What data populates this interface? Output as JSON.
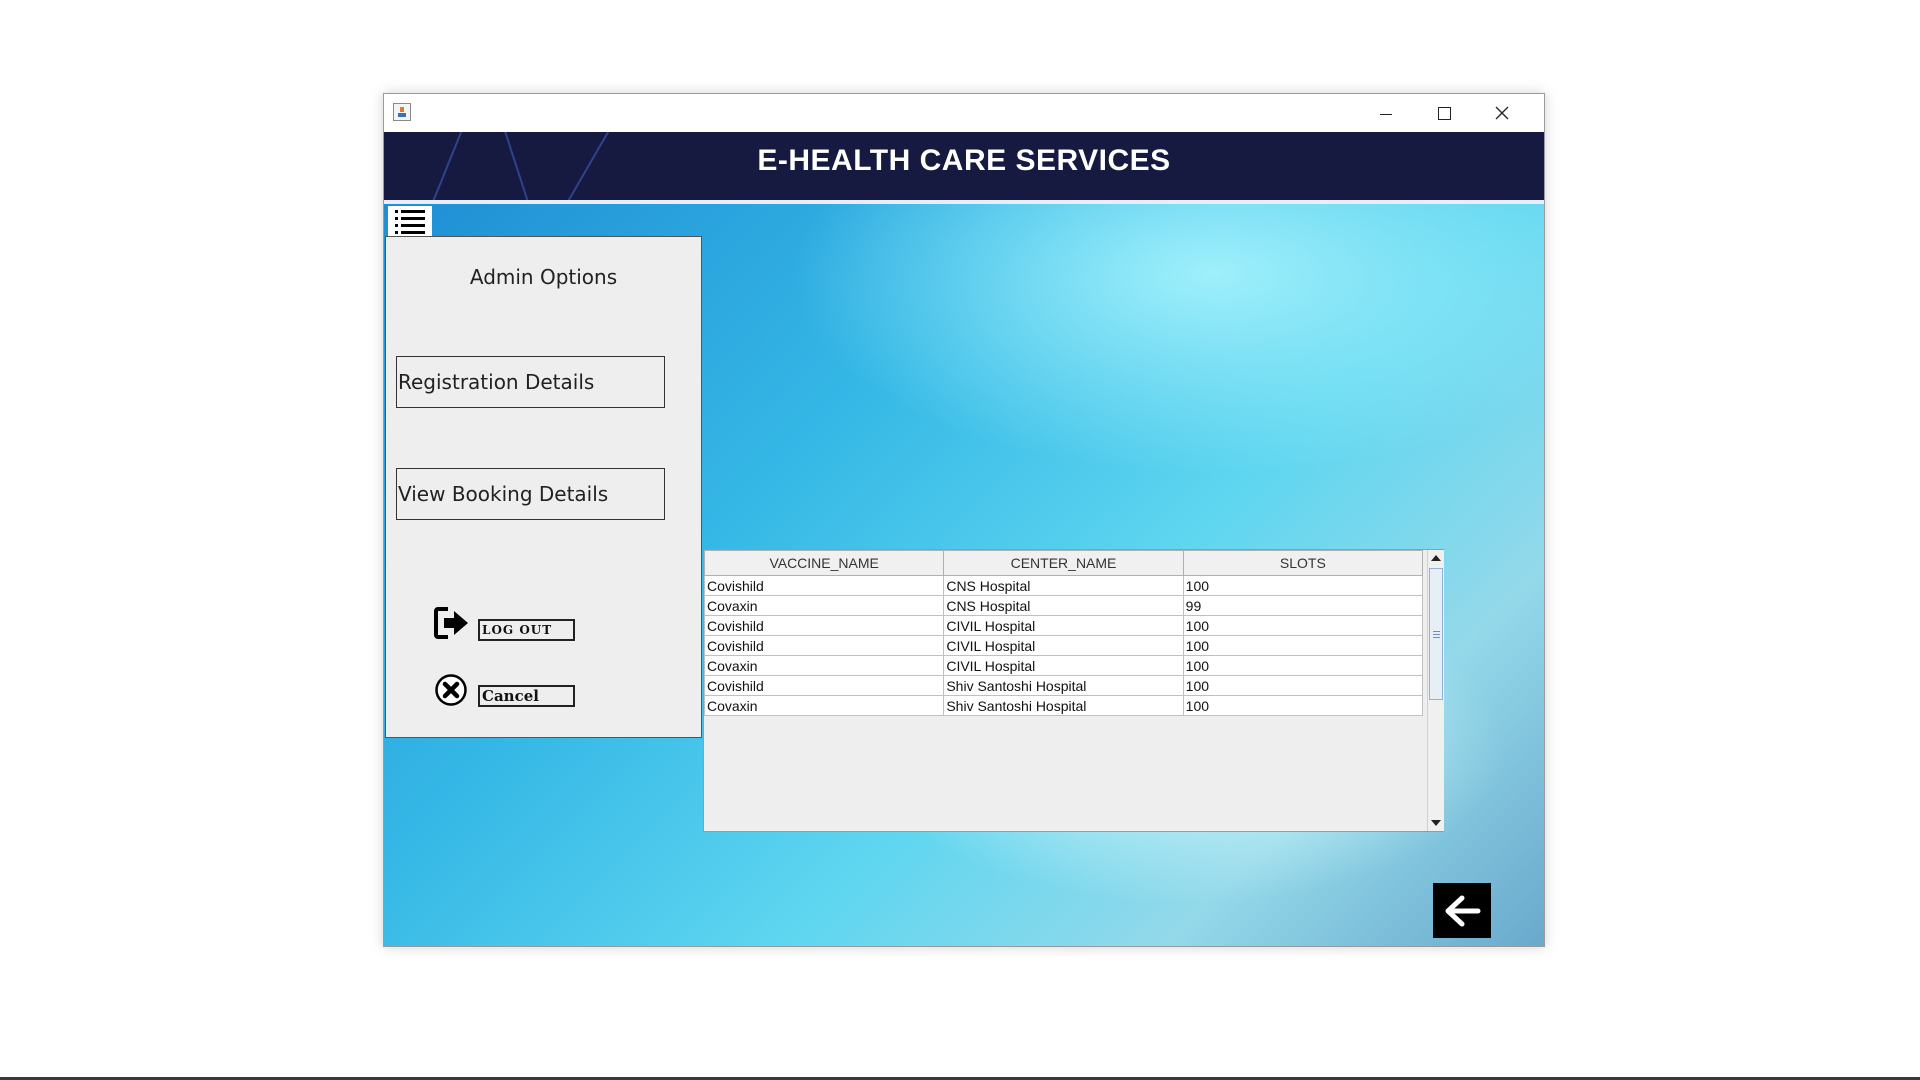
{
  "window": {
    "title": "",
    "icons": {
      "app": "java-cup-icon",
      "minimize": "minimize-icon",
      "maximize": "maximize-icon",
      "close": "close-icon"
    }
  },
  "header": {
    "title": "E-HEALTH CARE SERVICES",
    "background": "#161a40"
  },
  "menu": {
    "toggle_icon": "list-menu-icon"
  },
  "sidebar": {
    "title": "Admin Options",
    "registration_label": "Registration Details",
    "booking_label": "View Booking Details",
    "logout_label": "LOG OUT",
    "logout_icon": "logout-arrow-icon",
    "cancel_label": "Cancel",
    "cancel_icon": "cancel-x-circle-icon"
  },
  "table": {
    "columns": [
      "VACCINE_NAME",
      "CENTER_NAME",
      "SLOTS"
    ],
    "rows": [
      [
        "Covishild",
        "CNS Hospital",
        "100"
      ],
      [
        "Covaxin",
        "CNS Hospital",
        "99"
      ],
      [
        "Covishild",
        "CIVIL Hospital",
        "100"
      ],
      [
        "Covishild",
        "CIVIL Hospital",
        "100"
      ],
      [
        "Covaxin",
        "CIVIL Hospital",
        "100"
      ],
      [
        "Covishild",
        "Shiv Santoshi Hospital",
        "100"
      ],
      [
        "Covaxin",
        "Shiv Santoshi Hospital",
        "100"
      ]
    ]
  },
  "back_button": {
    "icon": "back-arrow-icon"
  }
}
